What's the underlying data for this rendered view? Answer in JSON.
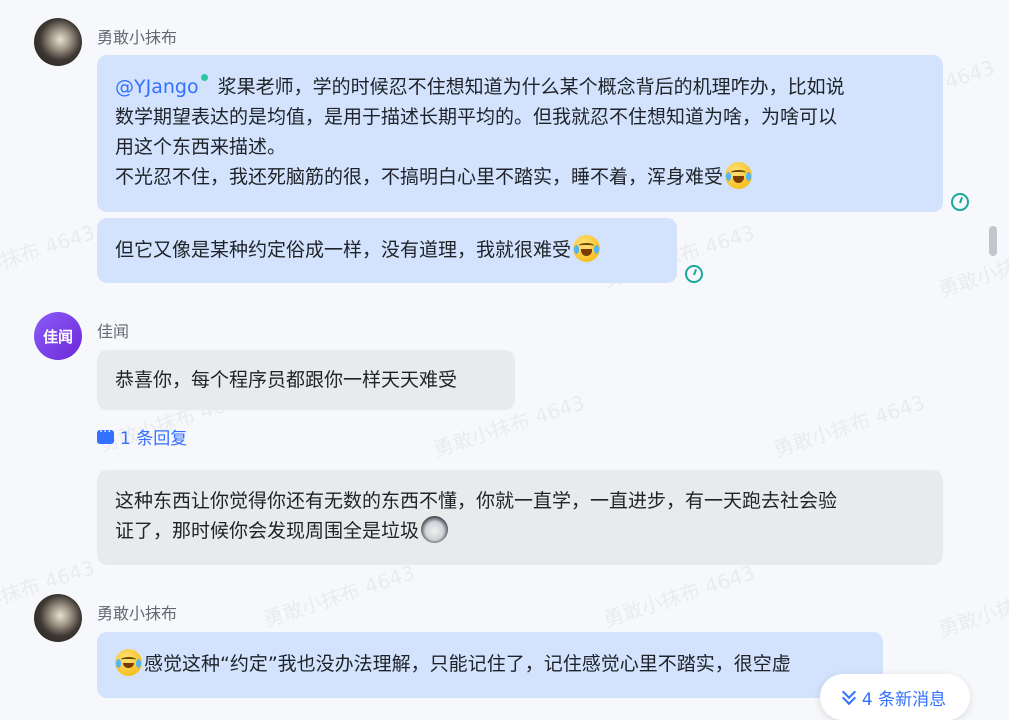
{
  "watermark_text": "勇敢小抹布 4643",
  "messages": [
    {
      "sender": "勇敢小抹布",
      "mention": "@YJango",
      "bubble1_lines": [
        "浆果老师，学的时候忍不住想知道为什么某个概念背后的机理咋办，比如说",
        "数学期望表达的是均值，是用于描述长期平均的。但我就忍不住想知道为啥，为啥可以",
        "用这个东西来描述。",
        "不光忍不住，我还死脑筋的很，不搞明白心里不踏实，睡不着，浑身难受"
      ],
      "bubble2_text": "但它又像是某种约定俗成一样，没有道理，我就很难受"
    },
    {
      "sender": "佳闻",
      "avatar_text": "佳闻",
      "bubble1_text": "恭喜你，每个程序员都跟你一样天天难受",
      "reply_count_label": "1 条回复",
      "bubble2_lines": [
        "这种东西让你觉得你还有无数的东西不懂，你就一直学，一直进步，有一天跑去社会验",
        "证了，那时候你会发现周围全是垃圾"
      ]
    },
    {
      "sender": "勇敢小抹布",
      "bubble_text": "感觉这种“约定”我也没办法理解，只能记住了，记住感觉心里不踏实，很空虚"
    }
  ],
  "new_messages_label": "4 条新消息",
  "icons": {
    "emoji_laugh_cry": "laughing-crying-emoji-icon",
    "emoji_dog": "dog-emoji-icon",
    "clock": "clock-icon",
    "reply": "reply-bubble-icon",
    "chevron": "double-chevron-down-icon"
  },
  "colors": {
    "own_bubble": "#d3e3fd",
    "other_bubble": "#e9eaec",
    "link": "#3370ff",
    "status": "#19a89a"
  }
}
